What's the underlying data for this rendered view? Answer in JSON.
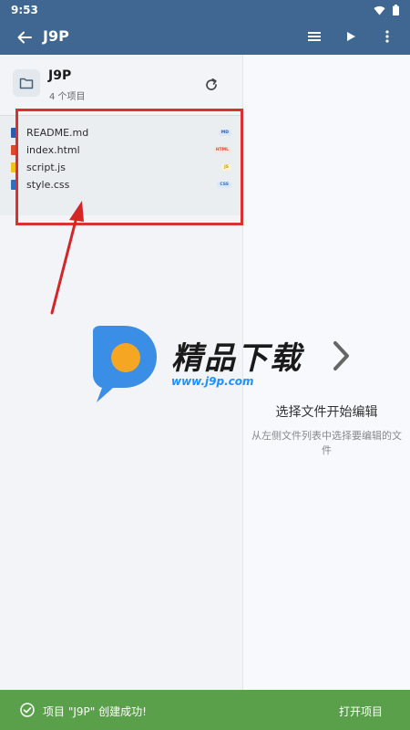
{
  "status_bar": {
    "time": "9:53"
  },
  "app_bar": {
    "title": "J9P",
    "icons": [
      "back-arrow-icon",
      "menu-icon",
      "play-icon",
      "more-vert-icon"
    ]
  },
  "sidebar": {
    "project_name": "J9P",
    "project_count": "4 个项目",
    "files": [
      {
        "name": "README.md",
        "badge": "MD",
        "color": "#2a5db0",
        "badge_bg": "#dde6f7",
        "badge_fg": "#2a5db0"
      },
      {
        "name": "index.html",
        "badge": "HTML",
        "color": "#e0482a",
        "badge_bg": "#fde4de",
        "badge_fg": "#e0482a"
      },
      {
        "name": "script.js",
        "badge": "JS",
        "color": "#f0c419",
        "badge_bg": "#fcf3cf",
        "badge_fg": "#c99c00"
      },
      {
        "name": "style.css",
        "badge": "CSS",
        "color": "#2f6fc0",
        "badge_bg": "#dbe8f8",
        "badge_fg": "#2f6fc0"
      }
    ]
  },
  "editor": {
    "empty_title": "选择文件开始编辑",
    "empty_desc": "从左侧文件列表中选择要编辑的文件"
  },
  "watermark": {
    "text": "精品下载",
    "url": "www.j9p.com"
  },
  "snackbar": {
    "message": "项目 \"J9P\" 创建成功!",
    "action": "打开项目"
  },
  "colors": {
    "app_bar": "#3f6791",
    "snackbar": "#5aa04a",
    "highlight": "#d93030"
  }
}
